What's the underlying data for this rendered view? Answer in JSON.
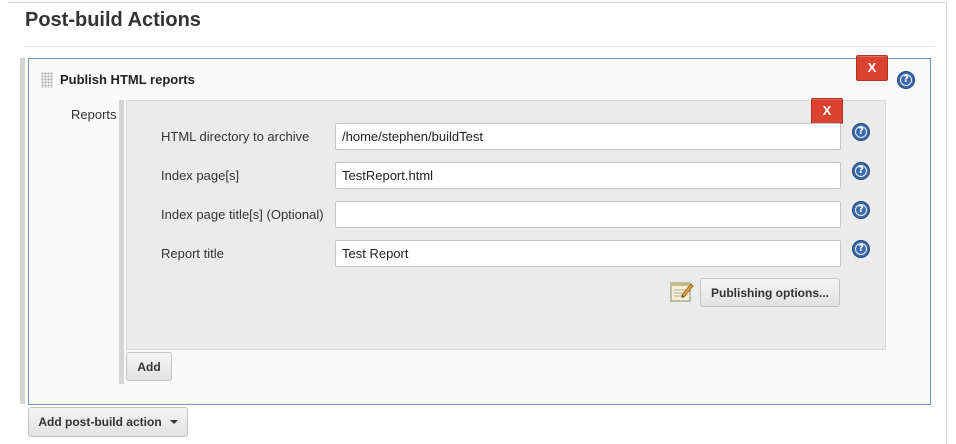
{
  "section": {
    "title": "Post-build Actions"
  },
  "step": {
    "title": "Publish HTML reports",
    "delete_label": "X",
    "help_symbol": "?"
  },
  "reports": {
    "label": "Reports",
    "delete_label": "X",
    "fields": [
      {
        "label": "HTML directory to archive",
        "value": "/home/stephen/buildTest"
      },
      {
        "label": "Index page[s]",
        "value": "TestReport.html"
      },
      {
        "label": "Index page title[s] (Optional)",
        "value": ""
      },
      {
        "label": "Report title",
        "value": "Test Report"
      }
    ],
    "publishing_options_label": "Publishing options...",
    "add_label": "Add"
  },
  "footer": {
    "add_post_build_label": "Add post-build action"
  },
  "colors": {
    "danger": "#d9432f",
    "panel_border": "#6f94c6",
    "help_blue": "#3b6aa8"
  },
  "icons": [
    "help-icon",
    "drag-handle-icon",
    "notepad-icon",
    "caret-down-icon"
  ]
}
